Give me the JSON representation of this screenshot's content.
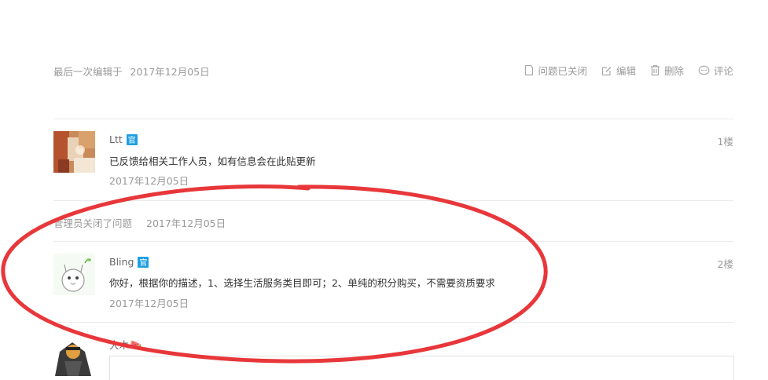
{
  "post_meta": {
    "last_edited_label": "最后一次编辑于",
    "last_edited_date": "2017年12月05日"
  },
  "actions": {
    "closed": "问题已关闭",
    "edit": "编辑",
    "delete": "删除",
    "comment": "评论"
  },
  "comments": [
    {
      "user": "Ltt",
      "badge": "官",
      "text": "已反馈给相关工作人员，如有信息会在此贴更新",
      "date": "2017年12月05日",
      "floor": "1楼"
    },
    {
      "user": "Bling",
      "badge": "官",
      "text": "你好，根据你的描述，1、选择生活服务类目即可；2、单纯的积分购买，不需要资质要求",
      "date": "2017年12月05日",
      "floor": "2楼"
    }
  ],
  "system_event": {
    "text": "管理员关闭了问题",
    "date": "2017年12月05日"
  },
  "next_user": {
    "user": "大木",
    "emoji": "🍉"
  },
  "colors": {
    "badge": "#1e9fe1",
    "annotation": "#e8373a",
    "muted_text": "#999999",
    "separator": "#ebebeb"
  }
}
